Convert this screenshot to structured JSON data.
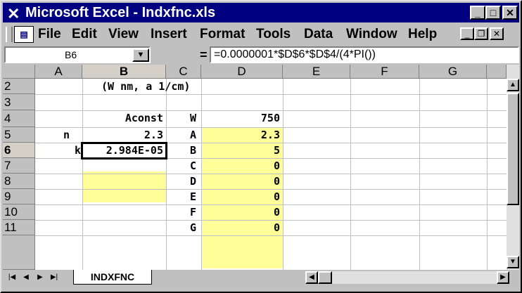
{
  "window": {
    "title": "Microsoft Excel - Indxfnc.xls",
    "app_icon": "excel-icon"
  },
  "menu": {
    "items": [
      "File",
      "Edit",
      "View",
      "Insert",
      "Format",
      "Tools",
      "Data",
      "Window",
      "Help"
    ]
  },
  "formula_bar": {
    "name_box": "B6",
    "equals": "=",
    "formula": "=0.0000001*$D$6*$D$4/(4*PI())"
  },
  "columns": [
    "A",
    "B",
    "C",
    "D",
    "E",
    "F",
    "G"
  ],
  "rows": [
    "2",
    "3",
    "4",
    "5",
    "6",
    "7",
    "8",
    "9",
    "10",
    "11"
  ],
  "cells": {
    "b2": "(W nm, a 1/cm)",
    "b4": "Aconst",
    "a5": "n",
    "b5": "2.3",
    "a6": "k",
    "b6": "2.984E-05",
    "c4": "W",
    "c5": "A",
    "c6": "B",
    "c7": "C",
    "c8": "D",
    "c9": "E",
    "c10": "F",
    "c11": "G",
    "d4": "750",
    "d5": "2.3",
    "d6": "5",
    "d7": "0",
    "d8": "0",
    "d9": "0",
    "d10": "0",
    "d11": "0"
  },
  "sheet_tab": "INDXFNC",
  "colors": {
    "title_bg": "#000080",
    "highlight": "#ffff99"
  }
}
